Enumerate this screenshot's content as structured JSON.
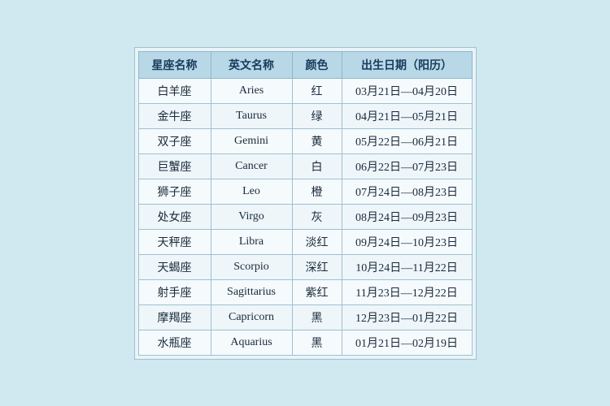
{
  "table": {
    "headers": [
      "星座名称",
      "英文名称",
      "颜色",
      "出生日期（阳历）"
    ],
    "rows": [
      {
        "chinese": "白羊座",
        "english": "Aries",
        "color": "红",
        "date": "03月21日—04月20日"
      },
      {
        "chinese": "金牛座",
        "english": "Taurus",
        "color": "绿",
        "date": "04月21日—05月21日"
      },
      {
        "chinese": "双子座",
        "english": "Gemini",
        "color": "黄",
        "date": "05月22日—06月21日"
      },
      {
        "chinese": "巨蟹座",
        "english": "Cancer",
        "color": "白",
        "date": "06月22日—07月23日"
      },
      {
        "chinese": "狮子座",
        "english": "Leo",
        "color": "橙",
        "date": "07月24日—08月23日"
      },
      {
        "chinese": "处女座",
        "english": "Virgo",
        "color": "灰",
        "date": "08月24日—09月23日"
      },
      {
        "chinese": "天秤座",
        "english": "Libra",
        "color": "淡红",
        "date": "09月24日—10月23日"
      },
      {
        "chinese": "天蝎座",
        "english": "Scorpio",
        "color": "深红",
        "date": "10月24日—11月22日"
      },
      {
        "chinese": "射手座",
        "english": "Sagittarius",
        "color": "紫红",
        "date": "11月23日—12月22日"
      },
      {
        "chinese": "摩羯座",
        "english": "Capricorn",
        "color": "黑",
        "date": "12月23日—01月22日"
      },
      {
        "chinese": "水瓶座",
        "english": "Aquarius",
        "color": "黑",
        "date": "01月21日—02月19日"
      }
    ]
  }
}
